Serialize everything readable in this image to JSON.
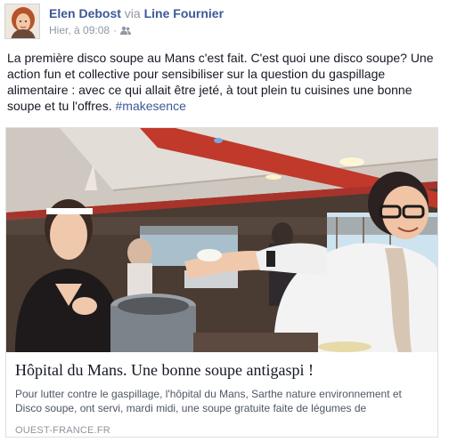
{
  "author": {
    "name": "Elen Debost",
    "via_word": "via",
    "via_page": "Line Fournier"
  },
  "timestamp": "Hier, à 09:08",
  "audience_icon": "friends-icon",
  "post": {
    "text": "La première disco soupe au Mans c'est fait. C'est quoi une disco soupe? Une action fun et collective pour sensibiliser sur la question du gaspillage alimentaire : avec ce qui allait être jeté, à tout plein tu cuisines une bonne soupe et tu l'offres. ",
    "hashtag": "#makesence"
  },
  "link_card": {
    "title": "Hôpital du Mans. Une bonne soupe antigaspi !",
    "description": "Pour lutter contre le gaspillage, l'hôpital du Mans, Sarthe nature environnement et Disco soupe, ont servi, mardi midi, une soupe gratuite faite de légumes de",
    "domain": "OUEST-FRANCE.FR"
  },
  "colors": {
    "link_blue": "#3b5998",
    "meta_gray": "#9197a3",
    "text": "#141823"
  }
}
